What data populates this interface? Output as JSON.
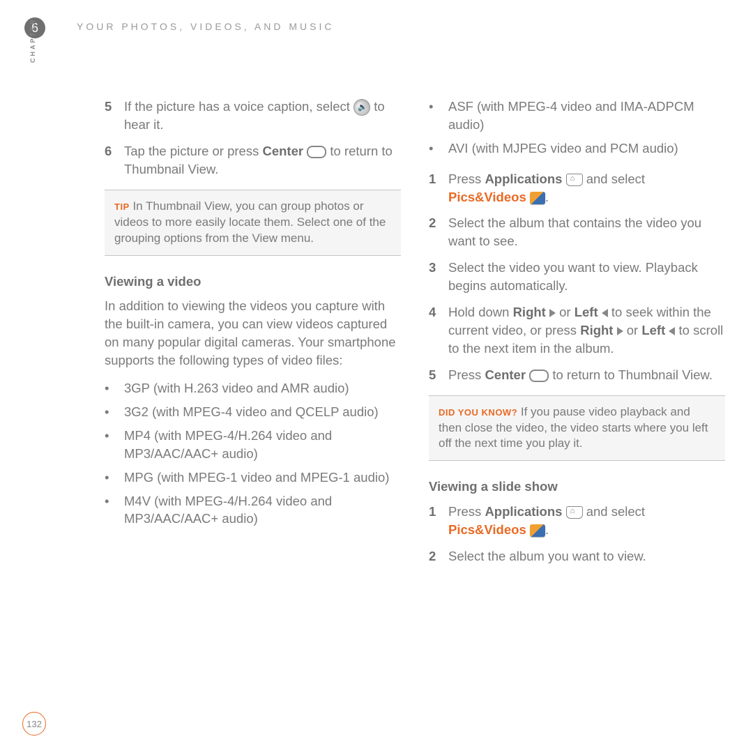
{
  "chapter_num": "6",
  "header": "YOUR PHOTOS, VIDEOS, AND MUSIC",
  "chapter_vert": "CHAPTER",
  "left": {
    "step5_num": "5",
    "step5a": "If the picture has a voice caption, select",
    "step5b": " to hear it.",
    "step6_num": "6",
    "step6a": "Tap the picture or press ",
    "step6_center": "Center",
    "step6b": " to return to Thumbnail View.",
    "tip_label": "TIP",
    "tip_text": " In Thumbnail View, you can group photos or videos to more easily locate them. Select one of the grouping options from the View menu.",
    "sec1": "Viewing a video",
    "para1": "In addition to viewing the videos you capture with the built-in camera, you can view videos captured on many popular digital cameras. Your smartphone supports the following types of video files:",
    "bul1": "3GP (with H.263 video and AMR audio)",
    "bul2": "3G2 (with MPEG-4 video and QCELP audio)",
    "bul3": "MP4 (with MPEG-4/H.264 video and MP3/AAC/AAC+ audio)",
    "bul4": "MPG (with MPEG-1 video and MPEG-1 audio)",
    "bul5": "M4V (with MPEG-4/H.264 video and MP3/AAC/AAC+ audio)"
  },
  "right": {
    "bul6": "ASF (with MPEG-4 video and IMA-ADPCM audio)",
    "bul7": "AVI (with MJPEG video and PCM audio)",
    "s1_num": "1",
    "s1a": "Press ",
    "s1_app": "Applications",
    "s1b": " and select ",
    "s1_pv": "Pics&Videos",
    "s1c": ".",
    "s2_num": "2",
    "s2": "Select the album that contains the video you want to see.",
    "s3_num": "3",
    "s3": "Select the video you want to view. Playback begins automatically.",
    "s4_num": "4",
    "s4a": "Hold down ",
    "s4_right": "Right",
    "s4b": " or ",
    "s4_left": "Left",
    "s4c": " to seek within the current video, or press ",
    "s4_right2": "Right",
    "s4d": " or ",
    "s4_left2": "Left",
    "s4e": " to scroll to the next item in the album.",
    "s5_num": "5",
    "s5a": "Press ",
    "s5_center": "Center",
    "s5b": " to return to Thumbnail View.",
    "dyk_label": "DID YOU KNOW?",
    "dyk_text": " If you pause video playback and then close the video, the video starts where you left off the next time you play it.",
    "sec2": "Viewing a slide show",
    "ss1_num": "1",
    "ss1a": "Press ",
    "ss1_app": "Applications",
    "ss1b": " and select ",
    "ss1_pv": "Pics&Videos",
    "ss1c": ".",
    "ss2_num": "2",
    "ss2": "Select the album you want to view."
  },
  "page": "132"
}
